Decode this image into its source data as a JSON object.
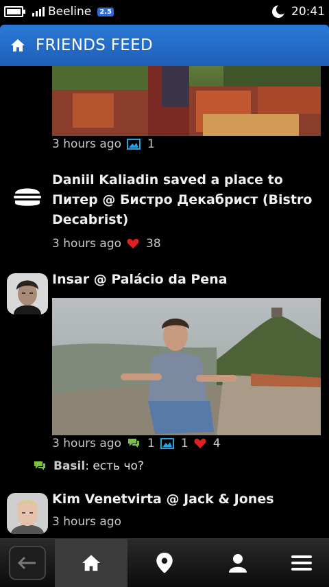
{
  "status": {
    "carrier": "Beeline",
    "network_badge": "2.5",
    "time": "20:41"
  },
  "header": {
    "title": "FRIENDS FEED"
  },
  "feed": [
    {
      "time": "3 hours ago",
      "photos": "1"
    },
    {
      "title": "Daniil Kaliadin saved a place to Питер @ Бистро Декабрист (Bistro Decabrist)",
      "time": "3 hours ago",
      "likes": "38",
      "icon": "burger-icon"
    },
    {
      "title": "Insar @ Palácio da Pena",
      "time": "3 hours ago",
      "comments": "1",
      "photos": "1",
      "likes": "4"
    },
    {
      "comment_author": "Basil",
      "comment_text": ": есть чо?"
    },
    {
      "title": "Kim Venetvirta @ Jack & Jones",
      "time": "3 hours ago"
    }
  ],
  "colors": {
    "accent": "#2a79d6",
    "comment_green": "#7bc043",
    "like_red": "#e02020",
    "photo_blue": "#29a3e0"
  }
}
